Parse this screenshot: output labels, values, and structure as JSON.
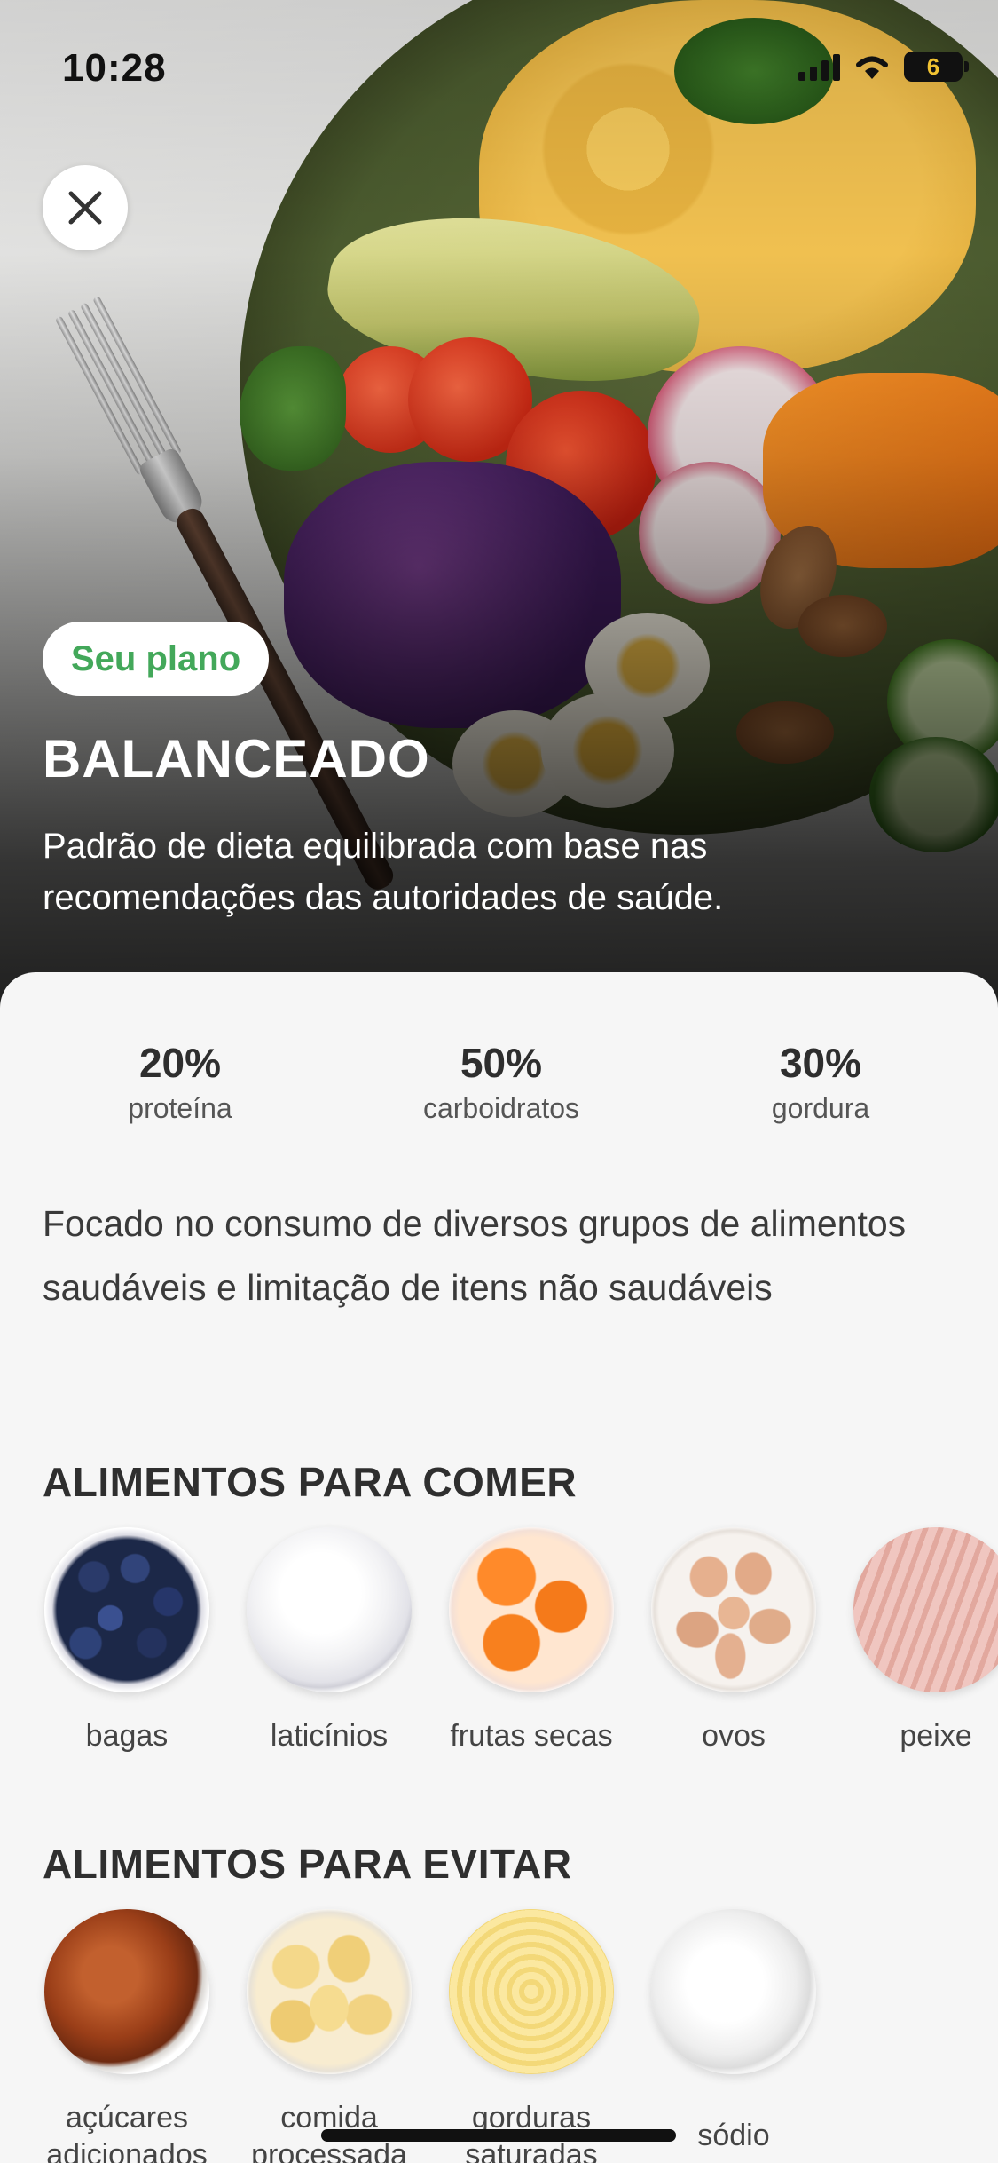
{
  "status_bar": {
    "time": "10:28",
    "battery": "6"
  },
  "hero": {
    "badge": "Seu plano",
    "title": "BALANCEADO",
    "description": "Padrão de dieta equilibrada com base nas recomendações das autoridades de saúde."
  },
  "macros": [
    {
      "value": "20%",
      "label": "proteína"
    },
    {
      "value": "50%",
      "label": "carboidratos"
    },
    {
      "value": "30%",
      "label": "gordura"
    }
  ],
  "focus_text": "Focado no consumo de diversos grupos de alimentos saudáveis e limitação de itens não saudáveis",
  "eat": {
    "title": "ALIMENTOS PARA COMER",
    "items": [
      {
        "label": "bagas",
        "icon": "blueberries-icon"
      },
      {
        "label": "laticínios",
        "icon": "yogurt-icon"
      },
      {
        "label": "frutas secas",
        "icon": "dried-apricots-icon"
      },
      {
        "label": "ovos",
        "icon": "eggs-icon"
      },
      {
        "label": "peixe",
        "icon": "fish-icon"
      }
    ]
  },
  "avoid": {
    "title": "ALIMENTOS PARA EVITAR",
    "items": [
      {
        "label": "açúcares adicionados",
        "icon": "caramel-sauce-icon"
      },
      {
        "label": "comida processada",
        "icon": "potato-chips-icon"
      },
      {
        "label": "gorduras saturadas",
        "icon": "butter-icon"
      },
      {
        "label": "sódio",
        "icon": "salt-icon"
      }
    ]
  },
  "colors": {
    "accent": "#43a85a",
    "text_dark": "#2f2f2f"
  }
}
